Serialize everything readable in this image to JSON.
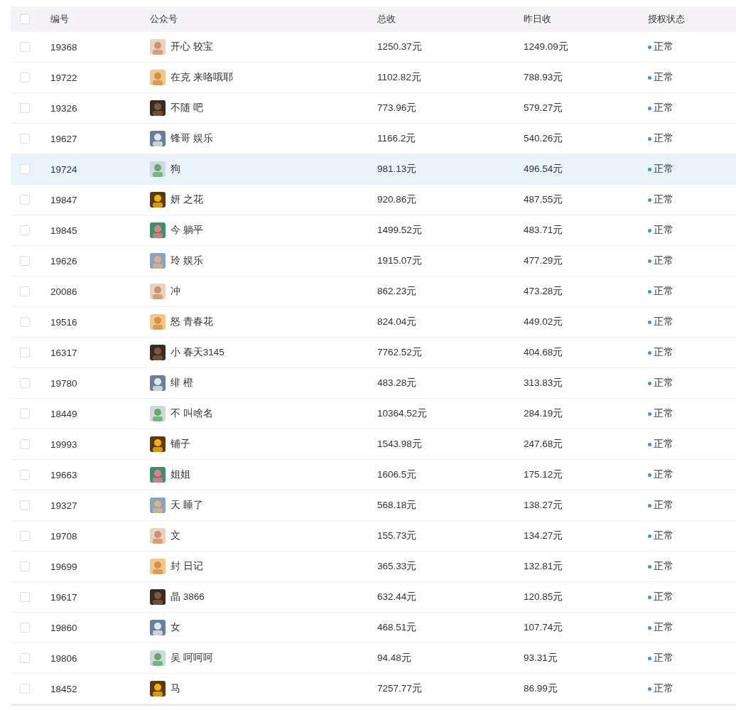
{
  "table": {
    "columns": [
      {
        "label": "编号"
      },
      {
        "label": "公众号"
      },
      {
        "label": "总收"
      },
      {
        "label": "昨日收"
      },
      {
        "label": "授权状态"
      }
    ],
    "header_checkbox": {
      "checked": false
    },
    "rows": [
      {
        "id": "19368",
        "name": "开心 较宝",
        "total": "1250.37元",
        "yesterday": "1249.09元",
        "status": "正常",
        "checked": false,
        "highlighted": false
      },
      {
        "id": "19722",
        "name": "在克 来咯哦耶",
        "total": "1102.82元",
        "yesterday": "788.93元",
        "status": "正常",
        "checked": false,
        "highlighted": false
      },
      {
        "id": "19326",
        "name": "不随 吧",
        "total": "773.96元",
        "yesterday": "579.27元",
        "status": "正常",
        "checked": false,
        "highlighted": false
      },
      {
        "id": "19627",
        "name": "锋哥 娱乐",
        "total": "1166.2元",
        "yesterday": "540.26元",
        "status": "正常",
        "checked": false,
        "highlighted": false
      },
      {
        "id": "19724",
        "name": "狗",
        "total": "981.13元",
        "yesterday": "496.54元",
        "status": "正常",
        "checked": false,
        "highlighted": true
      },
      {
        "id": "19847",
        "name": "妍 之花",
        "total": "920.86元",
        "yesterday": "487.55元",
        "status": "正常",
        "checked": false,
        "highlighted": false
      },
      {
        "id": "19845",
        "name": "今 躺平",
        "total": "1499.52元",
        "yesterday": "483.71元",
        "status": "正常",
        "checked": false,
        "highlighted": false
      },
      {
        "id": "19626",
        "name": "玲 娱乐",
        "total": "1915.07元",
        "yesterday": "477.29元",
        "status": "正常",
        "checked": false,
        "highlighted": false
      },
      {
        "id": "20086",
        "name": "冲",
        "total": "862.23元",
        "yesterday": "473.28元",
        "status": "正常",
        "checked": false,
        "highlighted": false
      },
      {
        "id": "19516",
        "name": "怒 青春花",
        "total": "824.04元",
        "yesterday": "449.02元",
        "status": "正常",
        "checked": false,
        "highlighted": false
      },
      {
        "id": "16317",
        "name": "小 春天3145",
        "total": "7762.52元",
        "yesterday": "404.68元",
        "status": "正常",
        "checked": false,
        "highlighted": false
      },
      {
        "id": "19780",
        "name": "绯 橙",
        "total": "483.28元",
        "yesterday": "313.83元",
        "status": "正常",
        "checked": false,
        "highlighted": false
      },
      {
        "id": "18449",
        "name": "不 叫啥名",
        "total": "10364.52元",
        "yesterday": "284.19元",
        "status": "正常",
        "checked": false,
        "highlighted": false
      },
      {
        "id": "19993",
        "name": "铺子",
        "total": "1543.98元",
        "yesterday": "247.68元",
        "status": "正常",
        "checked": false,
        "highlighted": false
      },
      {
        "id": "19663",
        "name": "姐姐",
        "total": "1606.5元",
        "yesterday": "175.12元",
        "status": "正常",
        "checked": false,
        "highlighted": false
      },
      {
        "id": "19327",
        "name": "天 睡了",
        "total": "568.18元",
        "yesterday": "138.27元",
        "status": "正常",
        "checked": false,
        "highlighted": false
      },
      {
        "id": "19708",
        "name": "文",
        "total": "155.73元",
        "yesterday": "134.27元",
        "status": "正常",
        "checked": false,
        "highlighted": false
      },
      {
        "id": "19699",
        "name": "封 日记",
        "total": "365.33元",
        "yesterday": "132.81元",
        "status": "正常",
        "checked": false,
        "highlighted": false
      },
      {
        "id": "19617",
        "name": "晶 3866",
        "total": "632.44元",
        "yesterday": "120.85元",
        "status": "正常",
        "checked": false,
        "highlighted": false
      },
      {
        "id": "19860",
        "name": "女",
        "total": "468.51元",
        "yesterday": "107.74元",
        "status": "正常",
        "checked": false,
        "highlighted": false
      },
      {
        "id": "19806",
        "name": "吴 呵呵呵",
        "total": "94.48元",
        "yesterday": "93.31元",
        "status": "正常",
        "checked": false,
        "highlighted": false
      },
      {
        "id": "18452",
        "name": "马",
        "total": "7257.77元",
        "yesterday": "86.99元",
        "status": "正常",
        "checked": false,
        "highlighted": false
      }
    ]
  }
}
